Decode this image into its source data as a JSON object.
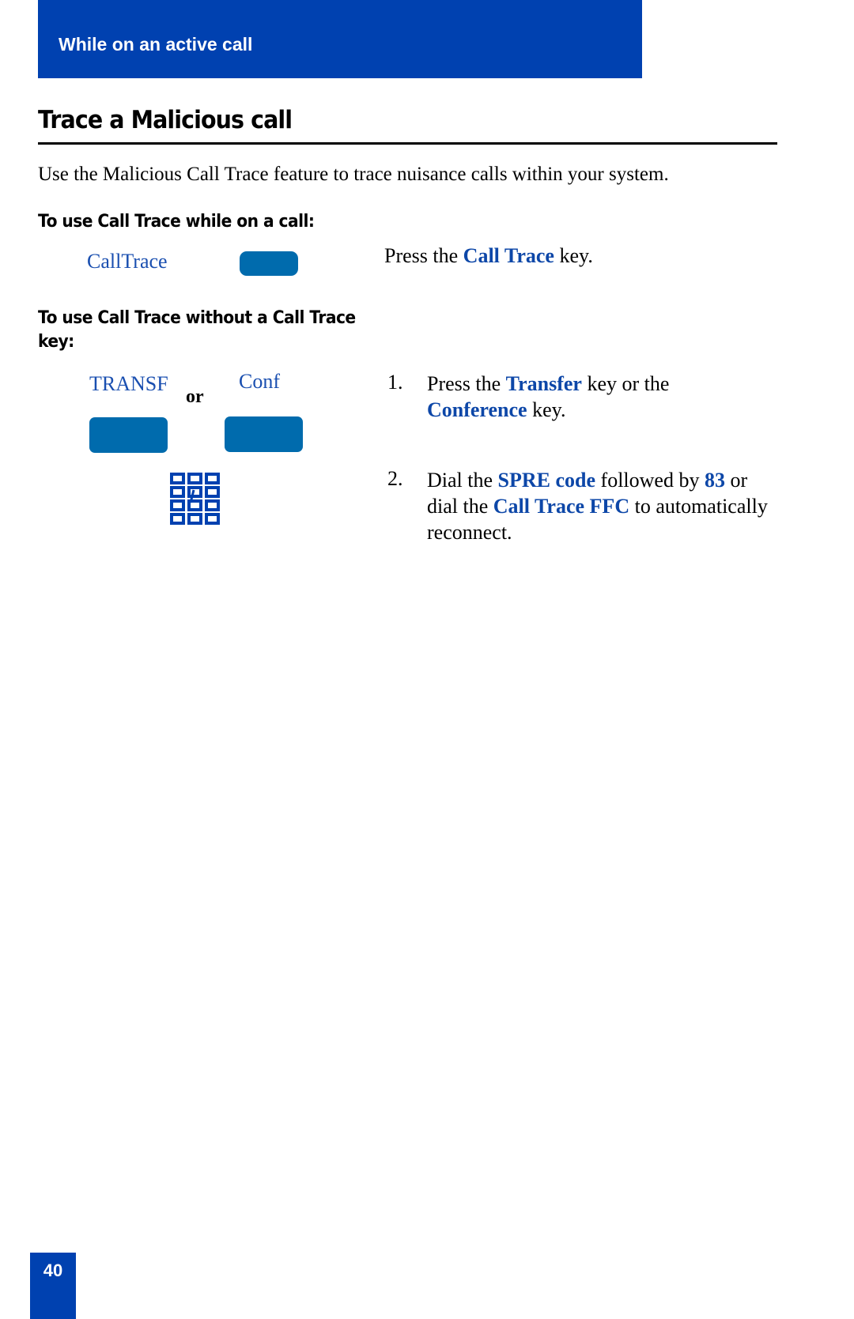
{
  "header": {
    "section_title": "While on an active call"
  },
  "page": {
    "title": "Trace a Malicious call",
    "intro": "Use the Malicious Call Trace feature to trace nuisance calls within your system.",
    "page_number": "40"
  },
  "section1": {
    "subheading": "To use Call Trace while on a call:",
    "key_label": "CallTrace",
    "instruction": {
      "before": "Press the ",
      "highlight": "Call Trace",
      "after": " key."
    }
  },
  "section2": {
    "subheading": "To use Call Trace without a Call Trace key:",
    "key_labels": {
      "transfer": "TRANSF",
      "conference": "Conf"
    },
    "or_label": "or",
    "keypad_icon": "dialpad-icon",
    "steps": [
      {
        "number": "1.",
        "parts": [
          {
            "text": "Press the ",
            "hl": false
          },
          {
            "text": "Transfer",
            "hl": true
          },
          {
            "text": " key or the ",
            "hl": false
          },
          {
            "text": "Conference",
            "hl": true
          },
          {
            "text": " key.",
            "hl": false
          }
        ]
      },
      {
        "number": "2.",
        "parts": [
          {
            "text": "Dial the ",
            "hl": false
          },
          {
            "text": "SPRE code",
            "hl": true
          },
          {
            "text": " followed by ",
            "hl": false
          },
          {
            "text": "83",
            "hl": true
          },
          {
            "text": " or dial the ",
            "hl": false
          },
          {
            "text": "Call Trace FFC",
            "hl": true
          },
          {
            "text": " to automatically reconnect.",
            "hl": false
          }
        ]
      }
    ]
  },
  "colors": {
    "brand_blue": "#0041b0",
    "key_blue": "#006bad",
    "highlight_blue": "#0d47a8"
  }
}
